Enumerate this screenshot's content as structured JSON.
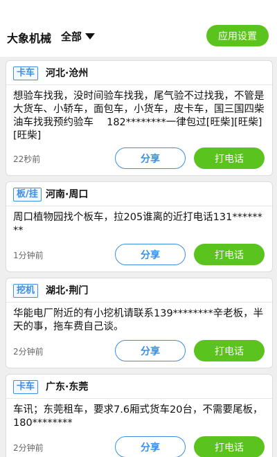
{
  "header": {
    "title": "大象机械",
    "filter_label": "全部",
    "settings_label": "应用设置"
  },
  "posts": [
    {
      "tag": "卡车",
      "location": "河北·沧州",
      "content": "想验车找我，没时间验车找我，尾气验不过找我，不管是大货车、小轿车，面包车，小货车，皮卡车，国三国四柴油车找我预约验车　 182********一律包过[旺柴][旺柴][旺柴]",
      "time": "22秒前",
      "share_label": "分享",
      "call_label": "打电话"
    },
    {
      "tag": "板/挂",
      "location": "河南·周口",
      "content": "周口植物园找个板车，拉205谁离的近打电话131********",
      "time": "1分钟前",
      "share_label": "分享",
      "call_label": "打电话"
    },
    {
      "tag": "挖机",
      "location": "湖北·荆门",
      "content": "华能电厂附近的有小挖机请联系139********辛老板，半天的事，拖车费自己谈。",
      "time": "2分钟前",
      "share_label": "分享",
      "call_label": "打电话"
    },
    {
      "tag": "卡车",
      "location": "广东·东莞",
      "content": "车讯；东莞租车，要求7.6厢式货车20台，不需要尾板，180********",
      "time": "2分钟前",
      "share_label": "分享",
      "call_label": "打电话"
    }
  ]
}
